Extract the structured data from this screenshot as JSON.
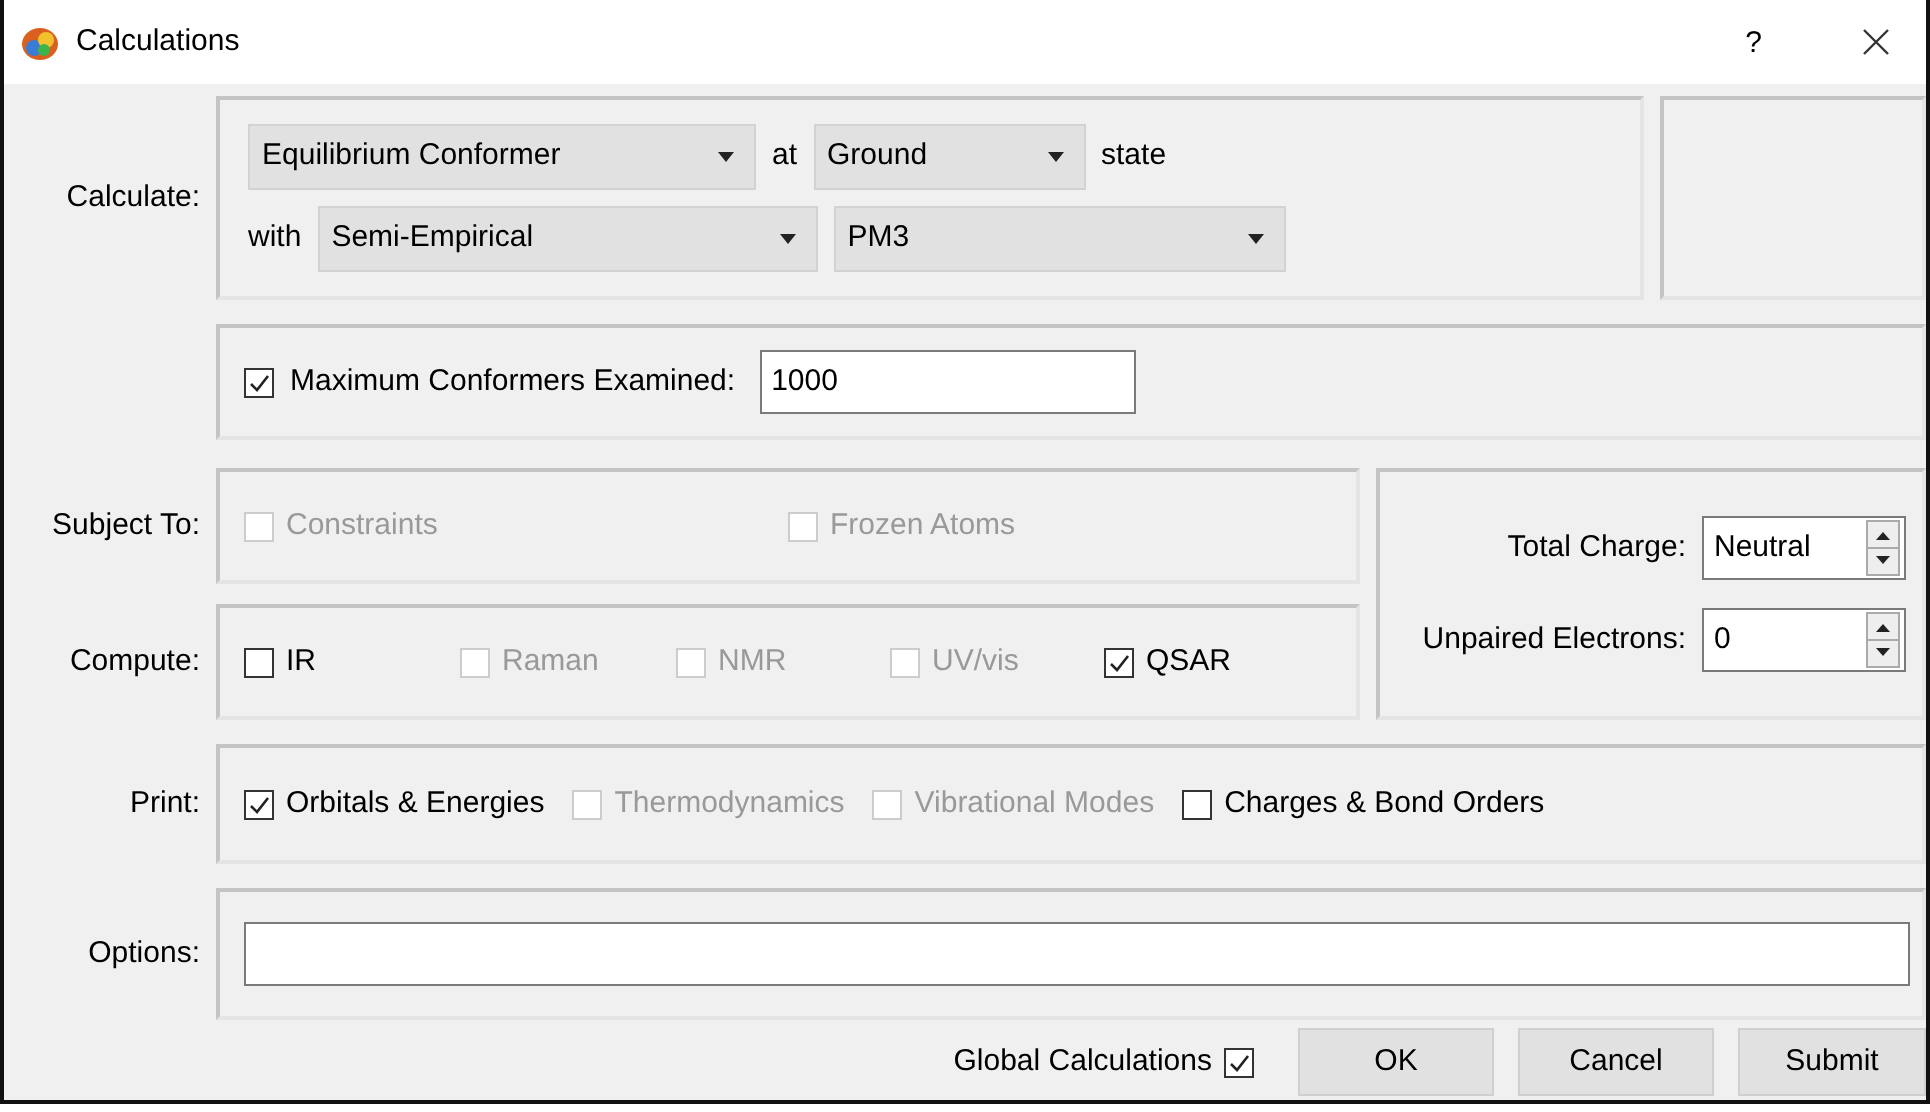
{
  "window": {
    "title": "Calculations",
    "help": "?"
  },
  "calculate": {
    "label": "Calculate:",
    "task": "Equilibrium Conformer",
    "at": "at",
    "state_value": "Ground",
    "state_word": "state",
    "with": "with",
    "method": "Semi-Empirical",
    "model": "PM3"
  },
  "max_conformers": {
    "checked": true,
    "label": "Maximum Conformers Examined:",
    "value": "1000"
  },
  "subject_to": {
    "label": "Subject To:",
    "options": [
      {
        "label": "Constraints",
        "checked": false,
        "disabled": true
      },
      {
        "label": "Frozen Atoms",
        "checked": false,
        "disabled": true
      }
    ]
  },
  "compute": {
    "label": "Compute:",
    "options": [
      {
        "label": "IR",
        "checked": false,
        "disabled": false
      },
      {
        "label": "Raman",
        "checked": false,
        "disabled": true
      },
      {
        "label": "NMR",
        "checked": false,
        "disabled": true
      },
      {
        "label": "UV/vis",
        "checked": false,
        "disabled": true
      },
      {
        "label": "QSAR",
        "checked": true,
        "disabled": false
      }
    ]
  },
  "charge": {
    "label": "Total Charge:",
    "value": "Neutral"
  },
  "unpaired": {
    "label": "Unpaired Electrons:",
    "value": "0"
  },
  "print": {
    "label": "Print:",
    "options": [
      {
        "label": "Orbitals & Energies",
        "checked": true,
        "disabled": false
      },
      {
        "label": "Thermodynamics",
        "checked": false,
        "disabled": true
      },
      {
        "label": "Vibrational Modes",
        "checked": false,
        "disabled": true
      },
      {
        "label": "Charges & Bond Orders",
        "checked": false,
        "disabled": false
      }
    ]
  },
  "options": {
    "label": "Options:"
  },
  "footer": {
    "global_label": "Global Calculations",
    "global_checked": true,
    "buttons": [
      "OK",
      "Cancel",
      "Submit"
    ]
  }
}
